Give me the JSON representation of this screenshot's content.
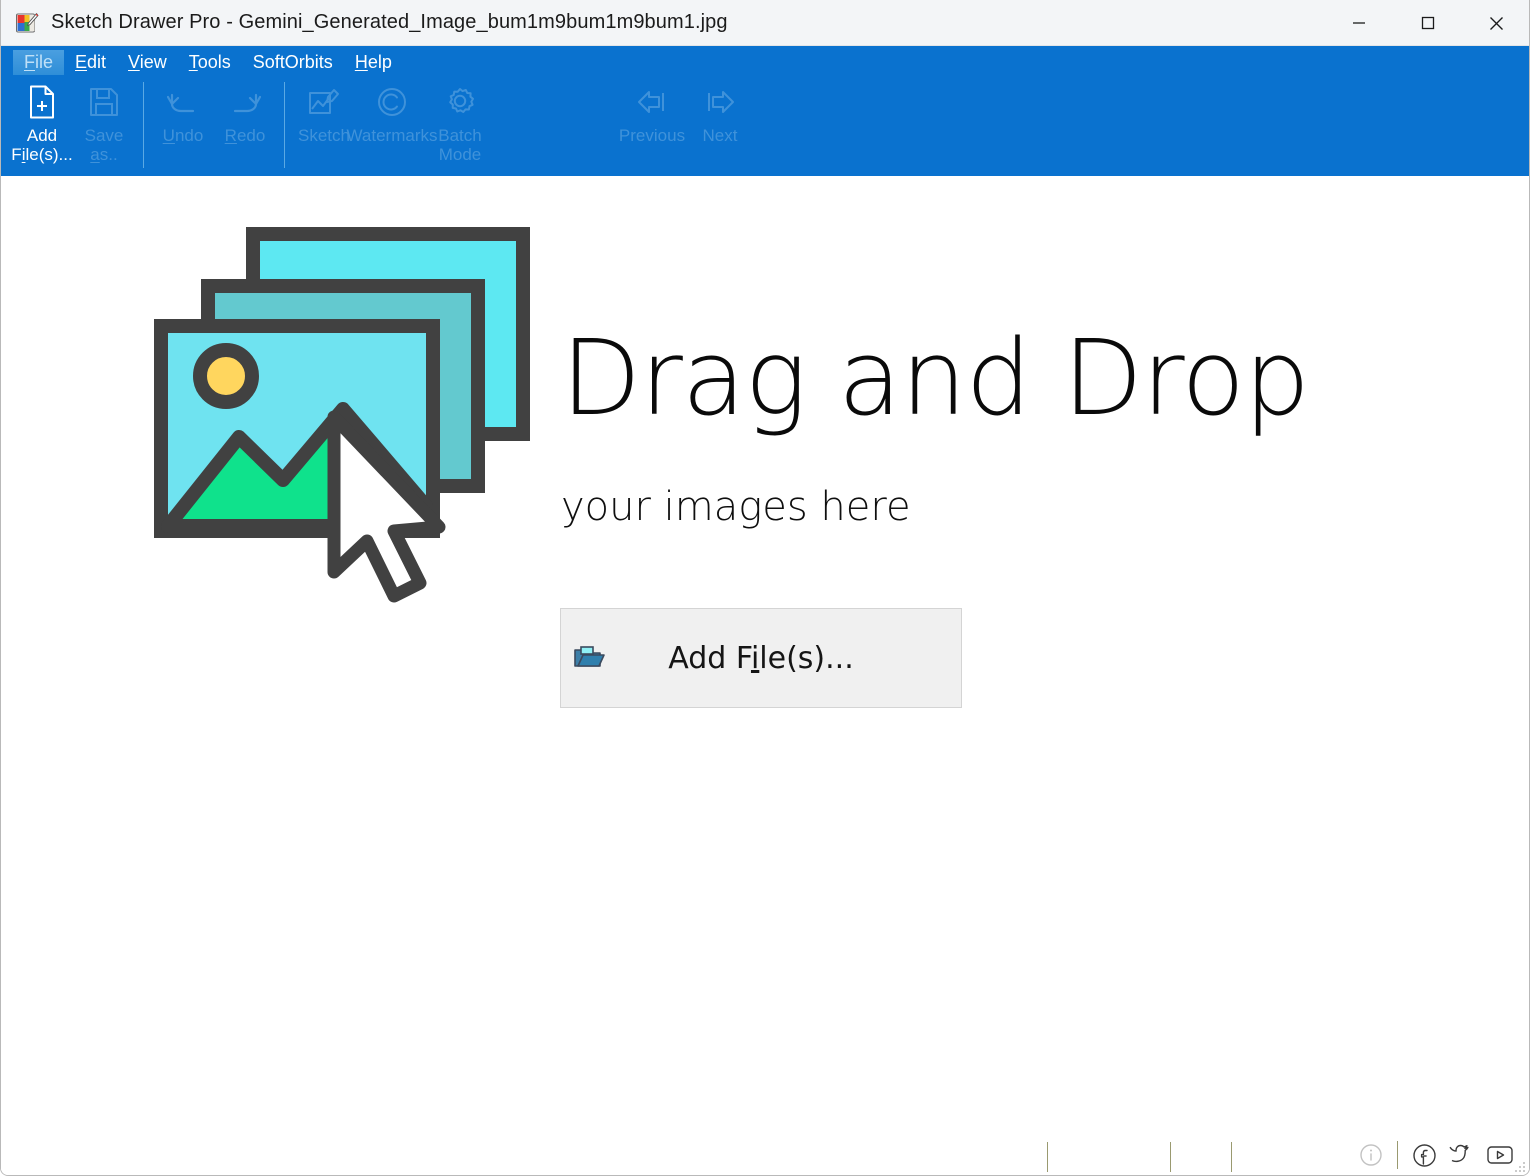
{
  "window": {
    "title": "Sketch Drawer Pro - Gemini_Generated_Image_bum1m9bum1m9bum1.jpg",
    "app_icon": "sketch-drawer-app-icon",
    "controls": {
      "minimize": "minimize-icon",
      "maximize": "maximize-icon",
      "close": "close-icon"
    },
    "colors": {
      "titlebar_bg": "#f3f5f7",
      "ribbon_bg": "#0a72cf",
      "menu_active_bg": "#2e8ed8",
      "canvas_bg": "#ffffff",
      "button_bg": "#f0f0f0",
      "disabled_text": "#3f92da"
    }
  },
  "menu": {
    "items": [
      {
        "label": "File",
        "accel": "F",
        "active": true
      },
      {
        "label": "Edit",
        "accel": "E",
        "active": false
      },
      {
        "label": "View",
        "accel": "V",
        "active": false
      },
      {
        "label": "Tools",
        "accel": "T",
        "active": false
      },
      {
        "label": "SoftOrbits",
        "accel": "",
        "active": false
      },
      {
        "label": "Help",
        "accel": "H",
        "active": false
      }
    ]
  },
  "toolbar": {
    "items": [
      {
        "id": "add-files",
        "line1": "Add",
        "line2": "File(s)...",
        "icon": "add-file-icon",
        "enabled": true
      },
      {
        "id": "save-as",
        "line1": "Save",
        "line2": "as..",
        "icon": "save-icon",
        "enabled": false
      },
      {
        "id": "undo",
        "line1": "",
        "line2": "Undo",
        "icon": "undo-icon",
        "enabled": false
      },
      {
        "id": "redo",
        "line1": "",
        "line2": "Redo",
        "icon": "redo-icon",
        "enabled": false
      },
      {
        "id": "sketch",
        "line1": "",
        "line2": "Sketch",
        "icon": "sketch-icon",
        "enabled": false
      },
      {
        "id": "watermarks",
        "line1": "",
        "line2": "Watermarks",
        "icon": "copyright-icon",
        "enabled": false
      },
      {
        "id": "batch-mode",
        "line1": "Batch",
        "line2": "Mode",
        "icon": "gear-icon",
        "enabled": false
      },
      {
        "id": "previous",
        "line1": "",
        "line2": "Previous",
        "icon": "arrow-left-icon",
        "enabled": false
      },
      {
        "id": "next",
        "line1": "",
        "line2": "Next",
        "icon": "arrow-right-icon",
        "enabled": false
      }
    ]
  },
  "drop_area": {
    "graphic": "images-with-cursor-icon",
    "title": "Drag and Drop",
    "subtitle": "your images here",
    "button": {
      "label": "Add File(s)...",
      "accel": "i",
      "icon": "open-folder-icon"
    }
  },
  "status_bar": {
    "sections": [
      "",
      "",
      "",
      ""
    ],
    "icons": [
      {
        "name": "info-icon",
        "title": "Info"
      },
      {
        "name": "facebook-icon",
        "title": "Facebook"
      },
      {
        "name": "twitter-icon",
        "title": "Twitter"
      },
      {
        "name": "youtube-icon",
        "title": "YouTube"
      }
    ]
  }
}
